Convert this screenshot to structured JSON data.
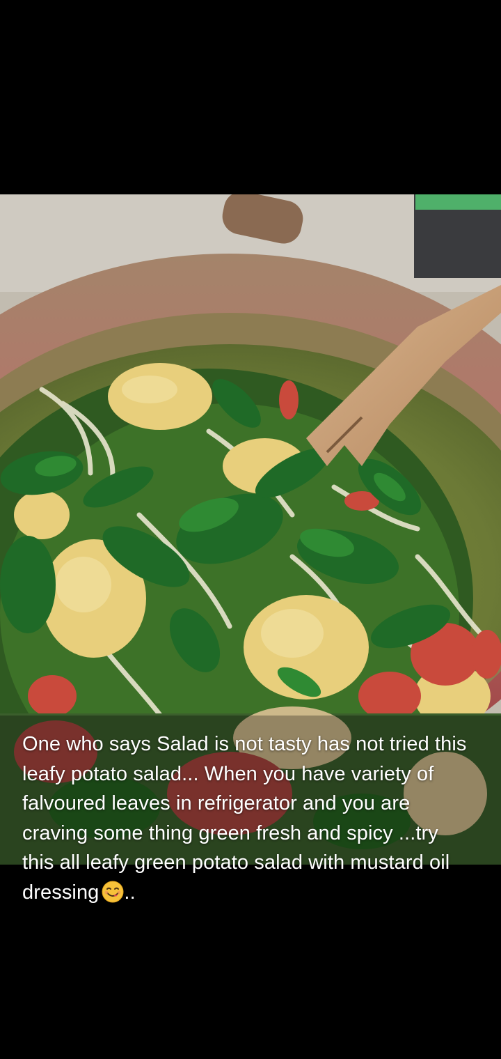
{
  "story": {
    "caption": "One who says Salad is not tasty has not tried this leafy potato salad... When you have variety of falvoured leaves in refrigerator and you are craving some thing green fresh and spicy ...try this all leafy green potato salad with mustard oil dressing",
    "caption_tail": "..",
    "emoji": "face-savoring-food-icon"
  },
  "colors": {
    "background": "#000000",
    "caption_text": "#ffffff"
  }
}
